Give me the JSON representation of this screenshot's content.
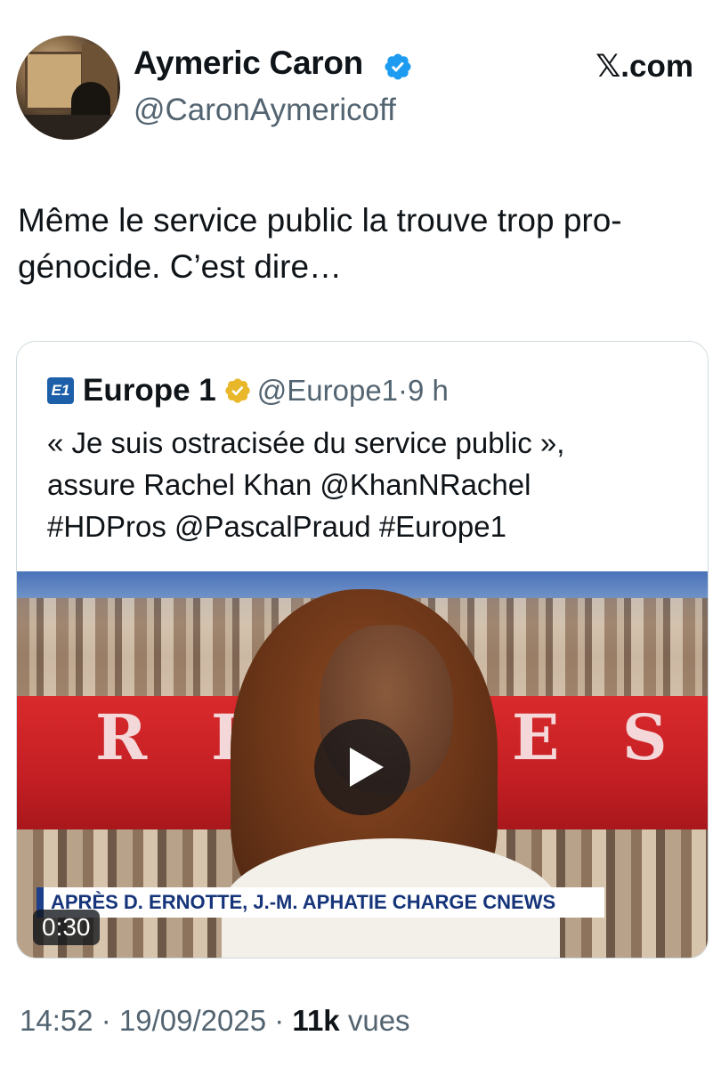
{
  "author": {
    "name": "Aymeric Caron",
    "handle": "@CaronAymericoff",
    "verified_icon": "verified-badge-icon",
    "badge_color": "#1d9bf0"
  },
  "source_label": "𝕏.com",
  "tweet": {
    "text": "Même le service public la trouve trop pro-\ngénocide. C’est dire…"
  },
  "quote": {
    "logo_text": "E1",
    "name": "Europe 1",
    "handle": "@Europe1",
    "separator": "·",
    "time": "9 h",
    "badge_color": "#e8b82a",
    "text": "« Je suis ostracisée du service public »,\nassure Rachel Khan @KhanNRachel\n#HDPros @PascalPraud #Europe1",
    "video": {
      "chyron": "APRÈS D. ERNOTTE, J.-M. APHATIE CHARGE CNEWS",
      "duration": "0:30",
      "studio_letters": [
        "R",
        "E",
        "E",
        "S"
      ]
    }
  },
  "meta": {
    "time": "14:52",
    "sep1": " · ",
    "date": "19/09/2025",
    "sep2": " · ",
    "views_count": "11k",
    "views_label": " vues"
  },
  "colors": {
    "text_primary": "#0f1419",
    "text_secondary": "#536471",
    "border": "#cfd9de",
    "accent": "#1d9bf0"
  }
}
